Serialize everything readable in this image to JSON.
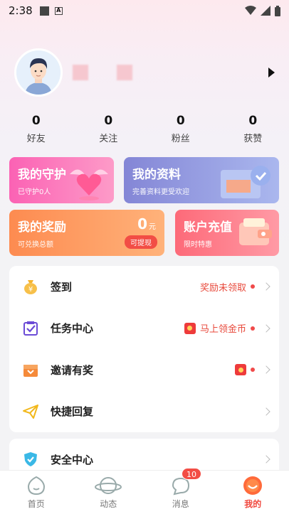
{
  "status_bar": {
    "time": "2:38"
  },
  "stats": [
    {
      "count": "0",
      "label": "好友"
    },
    {
      "count": "0",
      "label": "关注"
    },
    {
      "count": "0",
      "label": "粉丝"
    },
    {
      "count": "0",
      "label": "获赞"
    }
  ],
  "cards": {
    "guard": {
      "title": "我的守护",
      "sub": "已守护0人"
    },
    "info": {
      "title": "我的资料",
      "sub": "完善资料更受欢迎"
    },
    "reward": {
      "title": "我的奖励",
      "sub": "可兑换总额",
      "amount": "0",
      "unit": "元",
      "withdraw": "可提现"
    },
    "recharge": {
      "title": "账户充值",
      "sub": "限时特惠"
    }
  },
  "menu": {
    "checkin": {
      "label": "签到",
      "hint": "奖励未领取"
    },
    "tasks": {
      "label": "任务中心",
      "hint": "马上领金币"
    },
    "invite": {
      "label": "邀请有奖"
    },
    "quick_reply": {
      "label": "快捷回复"
    },
    "security": {
      "label": "安全中心"
    }
  },
  "tabs": [
    {
      "label": "首页"
    },
    {
      "label": "动态"
    },
    {
      "label": "消息",
      "badge": "10"
    },
    {
      "label": "我的"
    }
  ],
  "colors": {
    "accent": "#f0463c",
    "guard": "#fb62b4",
    "info": "#8486d6",
    "reward": "#fd8b50",
    "recharge": "#fd6a79"
  }
}
